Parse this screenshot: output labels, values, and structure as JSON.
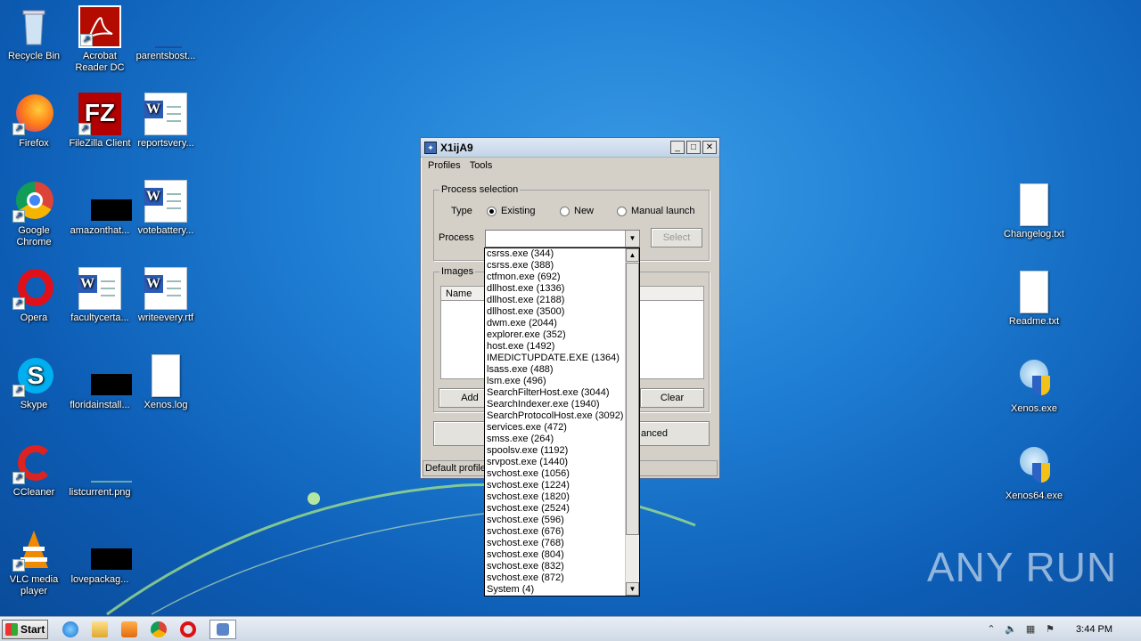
{
  "desktop": {
    "left_icons": [
      {
        "label": "Recycle Bin",
        "icon": "recycle-bin-icon"
      },
      {
        "label": "Acrobat Reader DC",
        "icon": "acrobat-icon"
      },
      {
        "label": "parentsbost...",
        "icon": "file-icon"
      },
      {
        "label": "Firefox",
        "icon": "firefox-icon"
      },
      {
        "label": "FileZilla Client",
        "icon": "filezilla-icon"
      },
      {
        "label": "reportsvery...",
        "icon": "word-doc-icon"
      },
      {
        "label": "Google Chrome",
        "icon": "chrome-icon"
      },
      {
        "label": "amazonthat...",
        "icon": "black-file-icon"
      },
      {
        "label": "votebattery...",
        "icon": "word-doc-icon"
      },
      {
        "label": "Opera",
        "icon": "opera-icon"
      },
      {
        "label": "facultycerta...",
        "icon": "word-doc-icon"
      },
      {
        "label": "writeevery.rtf",
        "icon": "word-doc-icon"
      },
      {
        "label": "Skype",
        "icon": "skype-icon"
      },
      {
        "label": "floridainstall...",
        "icon": "black-file-icon"
      },
      {
        "label": "Xenos.log",
        "icon": "text-file-icon"
      },
      {
        "label": "CCleaner",
        "icon": "ccleaner-icon"
      },
      {
        "label": "listcurrent.png",
        "icon": "image-file-icon"
      },
      {
        "label": "VLC media player",
        "icon": "vlc-icon"
      },
      {
        "label": "lovepackag...",
        "icon": "black-file-icon"
      }
    ],
    "right_icons": [
      {
        "label": "Changelog.txt",
        "icon": "text-file-icon"
      },
      {
        "label": "Readme.txt",
        "icon": "text-file-icon"
      },
      {
        "label": "Xenos.exe",
        "icon": "xenos-icon"
      },
      {
        "label": "Xenos64.exe",
        "icon": "xenos-icon"
      }
    ],
    "watermark": "ANY RUN"
  },
  "window": {
    "title": "X1ijA9",
    "menu": [
      "Profiles",
      "Tools"
    ],
    "process_selection": {
      "group_label": "Process selection",
      "type_label": "Type",
      "radios": [
        "Existing",
        "New",
        "Manual launch"
      ],
      "selected": "Existing",
      "process_label": "Process",
      "select_button": "Select"
    },
    "images": {
      "group_label": "Images",
      "column_name": "Name",
      "add_button": "Add",
      "clear_button": "Clear"
    },
    "advanced_button_partial": "anced",
    "status_text": "Default profile"
  },
  "dropdown_items": [
    "csrss.exe (344)",
    "csrss.exe (388)",
    "ctfmon.exe (692)",
    "dllhost.exe (1336)",
    "dllhost.exe (2188)",
    "dllhost.exe (3500)",
    "dwm.exe (2044)",
    "explorer.exe (352)",
    "host.exe (1492)",
    "IMEDICTUPDATE.EXE (1364)",
    "lsass.exe (488)",
    "lsm.exe (496)",
    "SearchFilterHost.exe (3044)",
    "SearchIndexer.exe (1940)",
    "SearchProtocolHost.exe (3092)",
    "services.exe (472)",
    "smss.exe (264)",
    "spoolsv.exe (1192)",
    "srvpost.exe (1440)",
    "svchost.exe (1056)",
    "svchost.exe (1224)",
    "svchost.exe (1820)",
    "svchost.exe (2524)",
    "svchost.exe (596)",
    "svchost.exe (676)",
    "svchost.exe (768)",
    "svchost.exe (804)",
    "svchost.exe (832)",
    "svchost.exe (872)",
    "System (4)"
  ],
  "taskbar": {
    "start_label": "Start",
    "clock": "3:44 PM"
  }
}
